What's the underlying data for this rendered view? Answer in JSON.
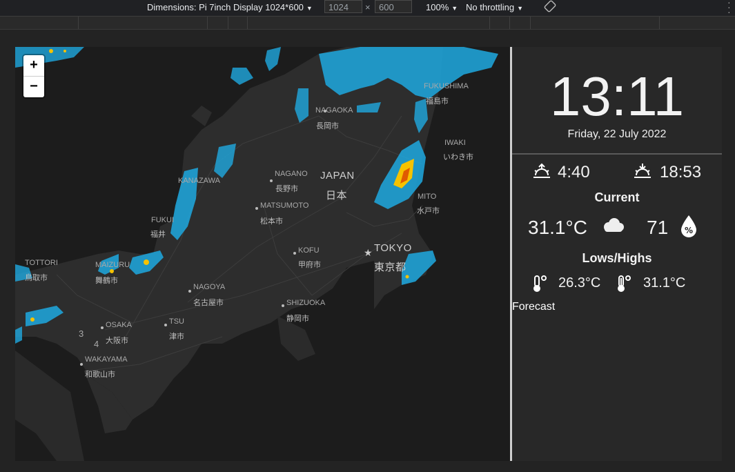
{
  "devtools": {
    "device": "Dimensions: Pi 7inch Display 1024*600",
    "width": "1024",
    "times": "×",
    "height": "600",
    "zoom": "100%",
    "throttle": "No throttling"
  },
  "map": {
    "zoom_in": "+",
    "zoom_out": "−",
    "labels": {
      "nagaoka": "NAGAOKA",
      "nagaoka_jp": "長岡市",
      "fukushima": "FUKUSHIMA",
      "fukushima_jp": "福島市",
      "iwaki": "IWAKI",
      "iwaki_jp": "いわき市",
      "kanazawa": "KANAZAWA",
      "nagano": "NAGANO",
      "nagano_jp": "長野市",
      "japan": "JAPAN",
      "japan_jp": "日本",
      "mito": "MITO",
      "mito_jp": "水戸市",
      "matsumoto": "MATSUMOTO",
      "matsumoto_jp": "松本市",
      "fukui": "FUKUI",
      "fukui_jp": "福井",
      "kofu": "KOFU",
      "kofu_jp": "甲府市",
      "tokyo": "TOKYO",
      "tokyo_jp": "東京都",
      "tottori": "TOTTORI",
      "tottori_jp": "鳥取市",
      "maizuru": "MAIZURU",
      "maizuru_jp": "舞鶴市",
      "nagoya": "NAGOYA",
      "nagoya_jp": "名古屋市",
      "shizuoka": "SHIZUOKA",
      "shizuoka_jp": "静岡市",
      "osaka": "OSAKA",
      "osaka_jp": "大阪市",
      "tsu": "TSU",
      "tsu_jp": "津市",
      "wakayama": "WAKAYAMA",
      "wakayama_jp": "和歌山市",
      "num3": "3",
      "num4": "4"
    }
  },
  "panel": {
    "time": "13:11",
    "date": "Friday, 22 July 2022",
    "sunrise": "4:40",
    "sunset": "18:53",
    "current_header": "Current",
    "temperature": "31.1°C",
    "humidity": "71",
    "lowhigh_header": "Lows/Highs",
    "low": "26.3°C",
    "high": "31.1°C",
    "forecast_label": "Forecast"
  },
  "colors": {
    "rain_light": "#1fa9e0",
    "rain_heavy": "#f6c200",
    "rain_core": "#e05a00"
  }
}
